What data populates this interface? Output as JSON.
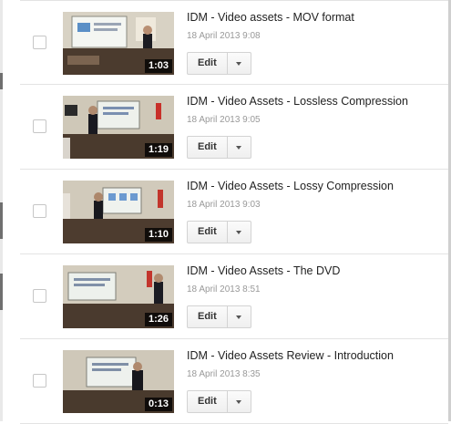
{
  "videos": [
    {
      "title": "IDM - Video assets - MOV format",
      "date": "18 April 2013 9:08",
      "duration": "1:03",
      "edit_label": "Edit",
      "thumbnail": "lecture-video-thumbnail"
    },
    {
      "title": "IDM - Video Assets - Lossless Compression",
      "date": "18 April 2013 9:05",
      "duration": "1:19",
      "edit_label": "Edit",
      "thumbnail": "lecture-video-thumbnail"
    },
    {
      "title": "IDM - Video Assets - Lossy Compression",
      "date": "18 April 2013 9:03",
      "duration": "1:10",
      "edit_label": "Edit",
      "thumbnail": "lecture-video-thumbnail"
    },
    {
      "title": "IDM - Video Assets - The DVD",
      "date": "18 April 2013 8:51",
      "duration": "1:26",
      "edit_label": "Edit",
      "thumbnail": "lecture-video-thumbnail"
    },
    {
      "title": "IDM - Video Assets Review - Introduction",
      "date": "18 April 2013 8:35",
      "duration": "0:13",
      "edit_label": "Edit",
      "thumbnail": "lecture-video-thumbnail"
    }
  ],
  "colors": {
    "title_text": "#222222",
    "date_text": "#999999",
    "border": "#e3e3e3",
    "duration_badge": "#000000"
  }
}
